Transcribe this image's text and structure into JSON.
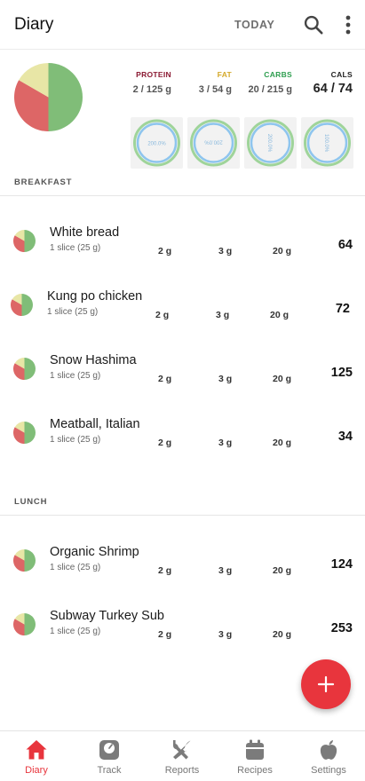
{
  "appbar": {
    "title": "Diary",
    "today_label": "TODAY",
    "search_icon": "search-icon",
    "more_icon": "more-vertical-icon"
  },
  "colors": {
    "protein": "#8b1a33",
    "fat": "#d4a92a",
    "carbs": "#2e9e4f",
    "pie_green": "#80bd78",
    "pie_red": "#dd6666",
    "pie_yellow": "#e8e6a6",
    "ring_green": "#9fd49a",
    "ring_blue": "#8ec5ee",
    "accent": "#e8353d"
  },
  "summary": {
    "macros": [
      {
        "label": "PROTEIN",
        "value": "2 / 125 g"
      },
      {
        "label": "FAT",
        "value": "3 / 54 g"
      },
      {
        "label": "CARBS",
        "value": "20 / 215 g"
      },
      {
        "label": "CALS",
        "value": "64 / 74"
      }
    ],
    "rings": [
      "200.0%",
      "200.0%",
      "200.0%",
      "100.0%"
    ]
  },
  "sections": [
    {
      "title": "BREAKFAST",
      "items": [
        {
          "name": "White bread",
          "serving": "1 slice (25 g)",
          "protein": "2 g",
          "fat": "3 g",
          "carbs": "20 g",
          "cals": "64"
        },
        {
          "name": "Kung po chicken",
          "serving": "1 slice (25 g)",
          "protein": "2 g",
          "fat": "3 g",
          "carbs": "20 g",
          "cals": "72"
        },
        {
          "name": "Snow Hashima",
          "serving": "1 slice (25 g)",
          "protein": "2 g",
          "fat": "3 g",
          "carbs": "20 g",
          "cals": "125"
        },
        {
          "name": "Meatball, Italian",
          "serving": "1 slice (25 g)",
          "protein": "2 g",
          "fat": "3 g",
          "carbs": "20 g",
          "cals": "34"
        }
      ]
    },
    {
      "title": "LUNCH",
      "items": [
        {
          "name": "Organic Shrimp",
          "serving": "1 slice (25 g)",
          "protein": "2 g",
          "fat": "3 g",
          "carbs": "20 g",
          "cals": "124"
        },
        {
          "name": "Subway Turkey Sub",
          "serving": "1 slice (25 g)",
          "protein": "2 g",
          "fat": "3 g",
          "carbs": "20 g",
          "cals": "253"
        }
      ]
    }
  ],
  "fab": {
    "icon": "plus-icon"
  },
  "nav": [
    {
      "label": "Diary",
      "icon": "home-icon"
    },
    {
      "label": "Track",
      "icon": "scale-icon"
    },
    {
      "label": "Reports",
      "icon": "fork-knife-icon"
    },
    {
      "label": "Recipes",
      "icon": "calendar-icon"
    },
    {
      "label": "Settings",
      "icon": "apple-icon"
    }
  ]
}
